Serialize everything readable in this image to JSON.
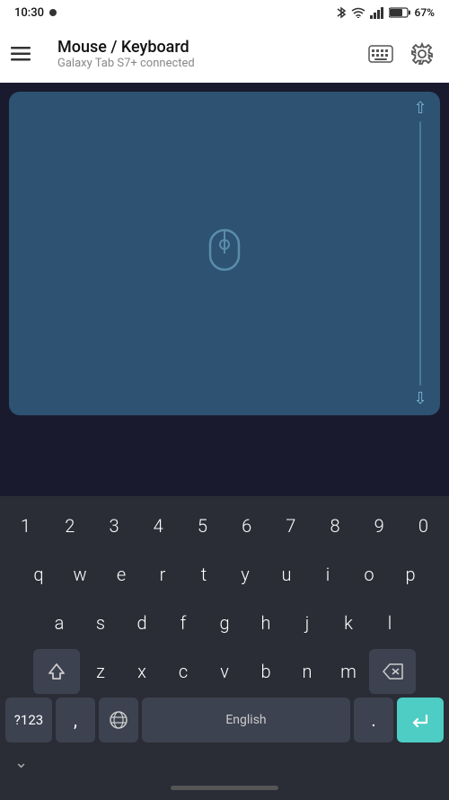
{
  "statusBar": {
    "time": "10:30",
    "battery": "67%"
  },
  "appBar": {
    "title": "Mouse / Keyboard",
    "subtitle": "Galaxy Tab S7+ connected"
  },
  "keyboard": {
    "row1": [
      "1",
      "2",
      "3",
      "4",
      "5",
      "6",
      "7",
      "8",
      "9",
      "0"
    ],
    "row2": [
      "q",
      "w",
      "e",
      "r",
      "t",
      "y",
      "u",
      "i",
      "o",
      "p"
    ],
    "row3": [
      "a",
      "s",
      "d",
      "f",
      "g",
      "h",
      "j",
      "k",
      "l"
    ],
    "row4": [
      "z",
      "x",
      "c",
      "v",
      "b",
      "n",
      "m"
    ],
    "numLabel": "?123",
    "commaLabel": ",",
    "spaceLabel": "English",
    "periodLabel": ".",
    "chevronLabel": "∨"
  }
}
